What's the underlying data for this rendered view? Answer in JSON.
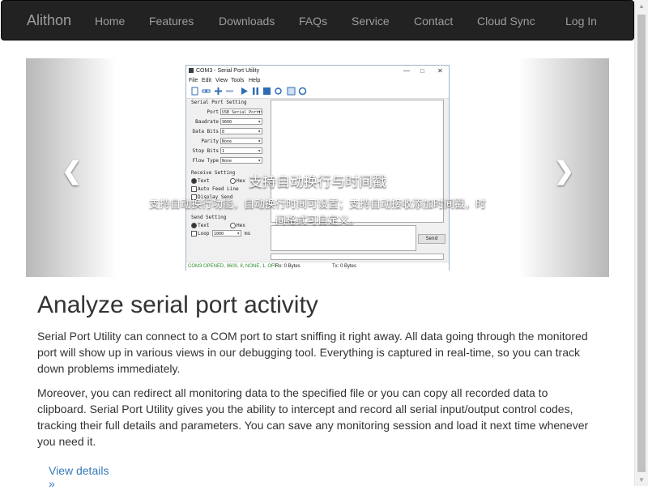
{
  "navbar": {
    "brand": "Alithon",
    "links": [
      "Home",
      "Features",
      "Downloads",
      "FAQs",
      "Service",
      "Contact",
      "Cloud Sync"
    ],
    "login": "Log In"
  },
  "carousel": {
    "caption_title": "支持自动换行与时间戳",
    "caption_text": "支持自动换行功能，自动换行时间可设置；支持自动接收添加时间戳，时间格式可自定义。",
    "prev_icon": "chevron-left",
    "next_icon": "chevron-right"
  },
  "app": {
    "title": "COM3 - Serial Port Utility",
    "menu": [
      "File",
      "Edit",
      "View",
      "Tools",
      "Help"
    ],
    "serial_port_setting": "Serial Port Setting",
    "fields": [
      {
        "label": "Port",
        "value": "USB Serial Port(COM"
      },
      {
        "label": "Baudrate",
        "value": "9600"
      },
      {
        "label": "Data Bits",
        "value": "8"
      },
      {
        "label": "Parity",
        "value": "None"
      },
      {
        "label": "Stop Bits",
        "value": "1"
      },
      {
        "label": "Flow Type",
        "value": "None"
      }
    ],
    "receive_setting": "Receive Setting",
    "receive_text": "Text",
    "receive_hex": "Hex",
    "auto_feed": "Auto Feed Line",
    "display_send": "Display Send",
    "send_setting": "Send Setting",
    "send_text": "Text",
    "send_hex": "Hex",
    "loop": "Loop",
    "loop_value": "1000",
    "loop_unit": "ms",
    "send_button": "Send",
    "status": "COM3 OPENED, 9600, 8, NONE, 1, OFF",
    "rx": "Rx: 0 Bytes",
    "tx": "Tx: 0 Bytes"
  },
  "content": {
    "headline": "Analyze serial port activity",
    "paragraph1": "Serial Port Utility can connect to a COM port to start sniffing it right away. All data going through the monitored port will show up in various views in our debugging tool. Everything is captured in real-time, so you can track down problems immediately.",
    "paragraph2": "Moreover, you can redirect all monitoring data to the specified file or you can copy all recorded data to clipboard. Serial Port Utility gives you the ability to intercept and record all serial input/output control codes, tracking their full details and parameters. You can save any monitoring session and load it next time whenever you need it.",
    "view_details": "View details »"
  },
  "colors": {
    "navbar_bg": "#222222",
    "nav_text": "#9d9d9d",
    "link": "#337ab7",
    "text": "#333333"
  }
}
